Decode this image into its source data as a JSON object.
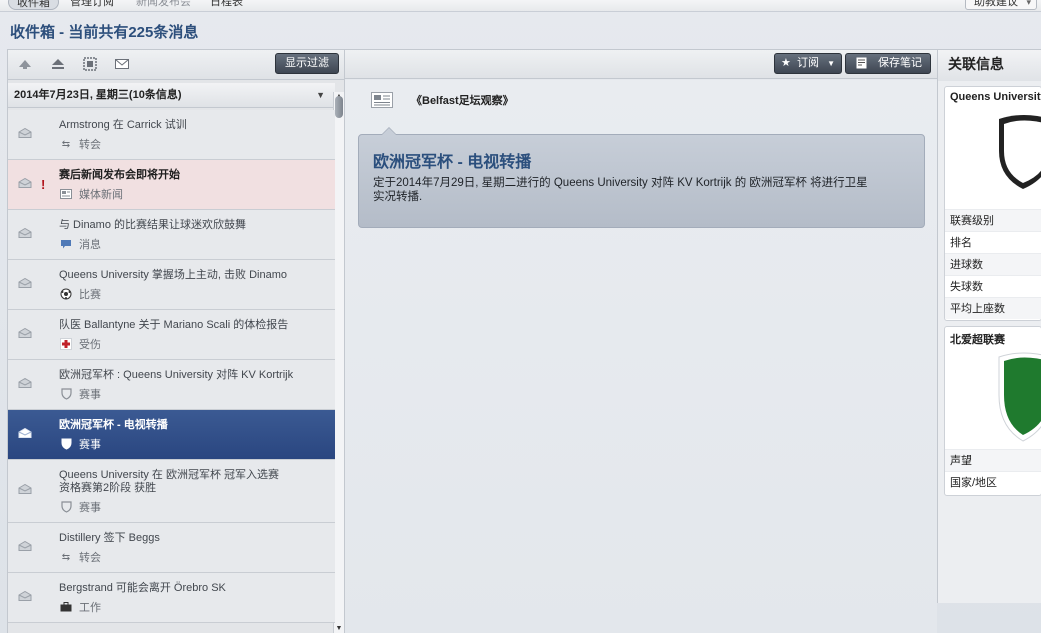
{
  "top_tabs": [
    {
      "label": "收件箱"
    },
    {
      "label": "管理订阅"
    },
    {
      "label": "新闻发布会"
    },
    {
      "label": "日程表"
    }
  ],
  "help_button": "助教建议",
  "page_title": "收件箱 - 当前共有225条消息",
  "left": {
    "filter_button": "显示过滤",
    "date_header": "2014年7月23日, 星期三(10条信息)",
    "messages": [
      {
        "title": "Armstrong 在 Carrick 试训",
        "category": "转会",
        "icon": "transfer-icon"
      },
      {
        "title": "赛后新闻发布会即将开始",
        "category": "媒体新闻",
        "icon": "media-icon"
      },
      {
        "title": "与 Dinamo 的比赛结果让球迷欢欣鼓舞",
        "category": "消息",
        "icon": "speech-bubble-icon"
      },
      {
        "title": "Queens University 掌握场上主动, 击败 Dinamo",
        "category": "比赛",
        "icon": "football-icon"
      },
      {
        "title": "队医 Ballantyne 关于 Mariano Scali 的体检报告",
        "category": "受伤",
        "icon": "medical-cross-icon"
      },
      {
        "title": "欧洲冠军杯 : Queens University 对阵 KV Kortrijk",
        "category": "赛事",
        "icon": "shield-icon"
      },
      {
        "title": "欧洲冠军杯 - 电视转播",
        "category": "赛事",
        "icon": "shield-icon"
      },
      {
        "title": "Queens University 在 欧洲冠军杯 冠军入选赛 资格赛第2阶段 获胜",
        "category": "赛事",
        "icon": "shield-icon"
      },
      {
        "title": "Distillery 签下 Beggs",
        "category": "转会",
        "icon": "transfer-icon"
      },
      {
        "title": "Bergstrand 可能会离开 Örebro SK",
        "category": "工作",
        "icon": "briefcase-icon"
      }
    ]
  },
  "middle": {
    "subscribe_button": "订阅",
    "save_note_button": "保存笔记",
    "source": "《Belfast足坛观察》",
    "headline": "欧洲冠军杯 - 电视转播",
    "body": "定于2014年7月29日, 星期二进行的 Queens University 对阵 KV Kortrijk 的 欧洲冠军杯 将进行卫星实况转播."
  },
  "right": {
    "header": "关联信息",
    "club_card": {
      "title": "Queens University",
      "rows": [
        "联赛级别",
        "排名",
        "进球数",
        "失球数",
        "平均上座数"
      ]
    },
    "league_card": {
      "title": "北爱超联赛",
      "rows": [
        "声望",
        "国家/地区"
      ]
    }
  },
  "colors": {
    "title_blue": "#2d4f7c",
    "selected_row": "#2f4c86",
    "alert_row": "#f1e0e1",
    "alert_mark": "#b1131b",
    "league_green": "#1f7a2e"
  }
}
